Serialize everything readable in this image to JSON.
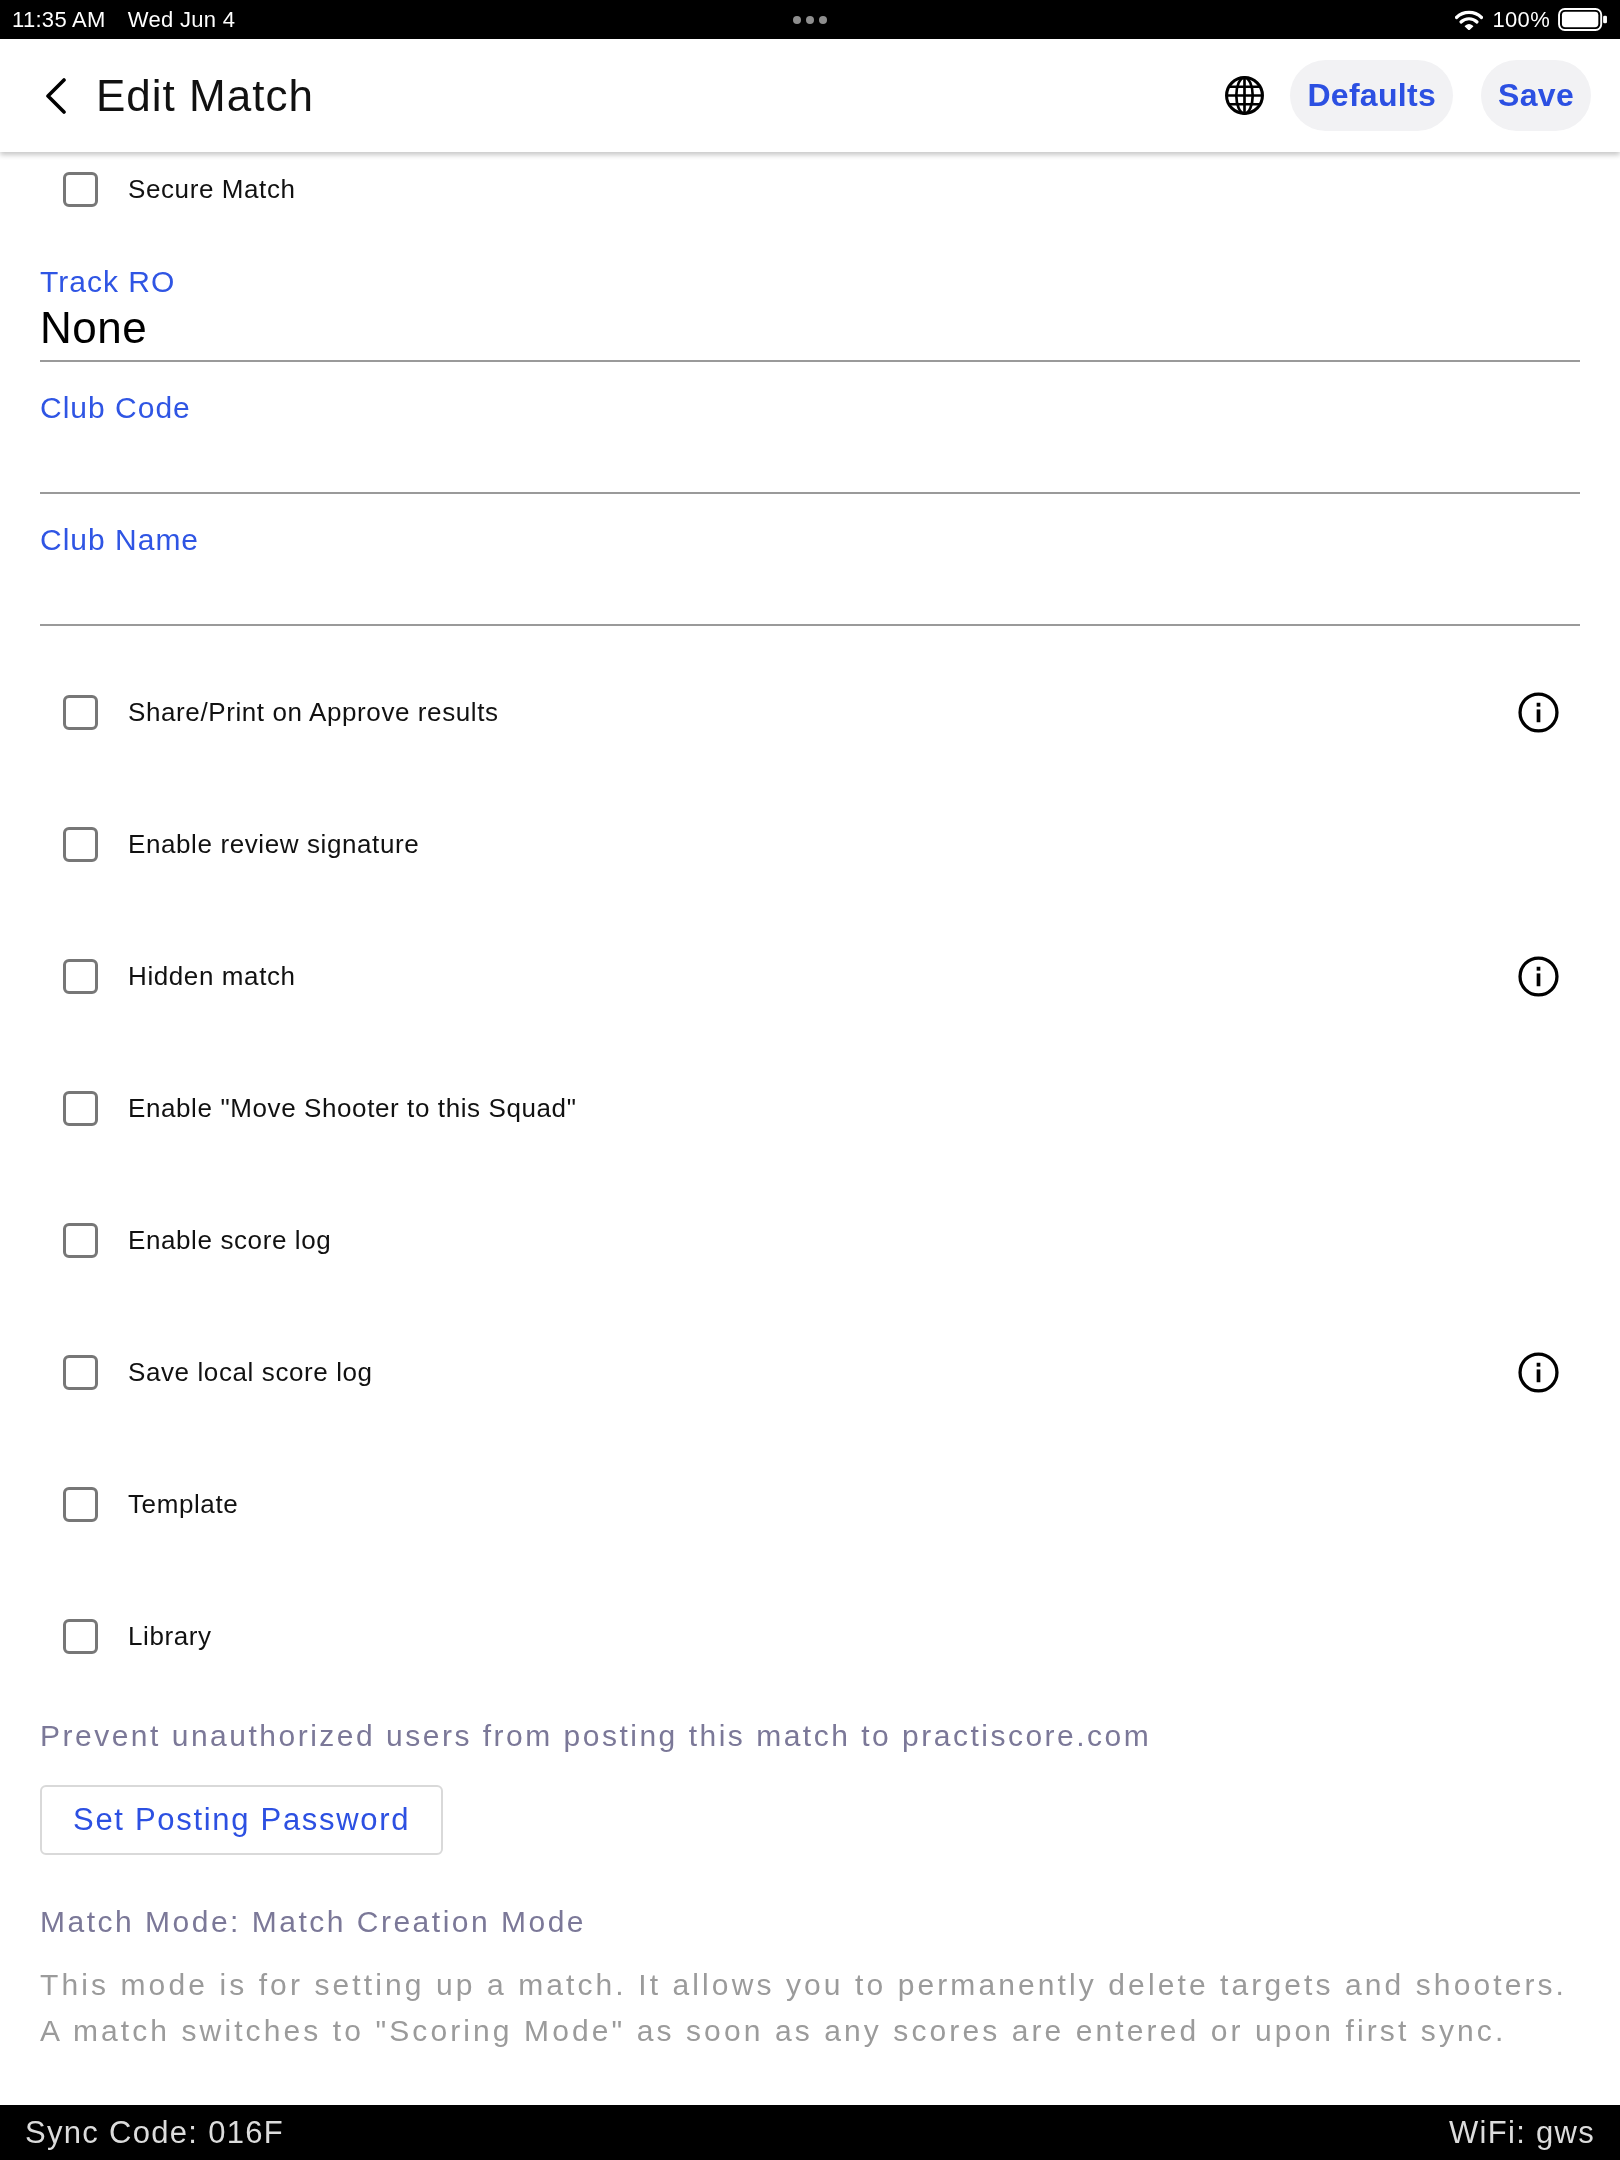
{
  "status_bar": {
    "time": "11:35 AM",
    "date": "Wed Jun 4",
    "battery": "100%"
  },
  "header": {
    "title": "Edit Match",
    "actions": [
      "Defaults",
      "Save"
    ]
  },
  "secure_match": {
    "label": "Secure Match",
    "checked": false
  },
  "fields": [
    {
      "kind": "select",
      "label": "Track RO",
      "value": "None"
    },
    {
      "kind": "text",
      "label": "Club Code"
    },
    {
      "kind": "text",
      "label": "Club Name"
    }
  ],
  "options": [
    {
      "label": "Share/Print on Approve results",
      "checked": false,
      "info": true
    },
    {
      "label": "Enable review signature",
      "checked": false,
      "info": false
    },
    {
      "label": "Hidden match",
      "checked": false,
      "info": true
    },
    {
      "label": "Enable \"Move Shooter to this Squad\"",
      "checked": false,
      "info": false
    },
    {
      "label": "Enable score log",
      "checked": false,
      "info": false
    },
    {
      "label": "Save local score log",
      "checked": false,
      "info": true
    },
    {
      "label": "Template",
      "checked": false,
      "info": false
    },
    {
      "label": "Library",
      "checked": false,
      "info": false
    }
  ],
  "posting": {
    "note": "Prevent unauthorized users from posting this match to practiscore.com",
    "button": "Set Posting Password"
  },
  "match_mode": {
    "title": "Match Mode: Match Creation Mode",
    "description": "This mode is for setting up a match. It allows you to permanently delete targets and shooters. A match switches to \"Scoring Mode\" as soon as any scores are entered or upon first sync."
  },
  "footer": {
    "sync_code": "Sync Code: 016F",
    "wifi": "WiFi: gws"
  }
}
